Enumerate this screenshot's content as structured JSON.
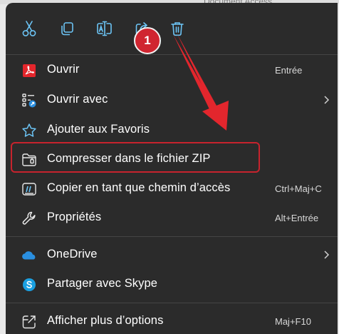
{
  "background": {
    "snippet": "Document Access..."
  },
  "toolbar": {
    "items": [
      {
        "icon": "scissors-icon"
      },
      {
        "icon": "copy-icon"
      },
      {
        "icon": "rename-icon"
      },
      {
        "icon": "share-icon"
      },
      {
        "icon": "trash-icon"
      }
    ]
  },
  "menu": {
    "items": [
      {
        "label": "Ouvrir",
        "shortcut": "Entrée",
        "icon": "pdf-icon"
      },
      {
        "label": "Ouvrir avec",
        "shortcut": "",
        "icon": "open-with-icon",
        "submenu": true
      },
      {
        "label": "Ajouter aux Favoris",
        "shortcut": "",
        "icon": "star-icon"
      },
      {
        "label": "Compresser dans le fichier ZIP",
        "shortcut": "",
        "icon": "zip-folder-icon"
      },
      {
        "label": "Copier en tant que chemin d’accès",
        "shortcut": "Ctrl+Maj+C",
        "icon": "copy-path-icon"
      },
      {
        "label": "Propriétés",
        "shortcut": "Alt+Entrée",
        "icon": "wrench-icon"
      },
      {
        "label": "OneDrive",
        "shortcut": "",
        "icon": "onedrive-icon",
        "submenu": true
      },
      {
        "label": "Partager avec Skype",
        "shortcut": "",
        "icon": "skype-icon"
      },
      {
        "label": "Afficher plus d’options",
        "shortcut": "Maj+F10",
        "icon": "more-options-icon"
      }
    ]
  },
  "annotation": {
    "step": "1"
  },
  "colors": {
    "menu_bg": "#2b2b2b",
    "text": "#ffffff",
    "accent_icon": "#6cc4f5",
    "pdf_red": "#e4262c",
    "highlight_red": "#c7232d",
    "arrow_red": "#e3262d",
    "skype_blue": "#1aa0e1",
    "onedrive_blue": "#2a8fe0"
  }
}
